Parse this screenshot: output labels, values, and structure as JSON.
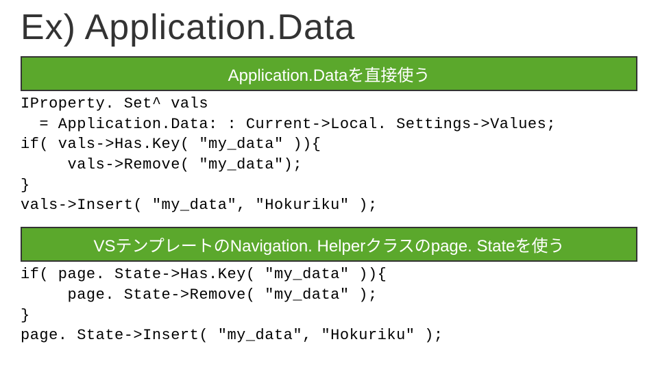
{
  "title": "Ex) Application.Data",
  "banner1": "Application.Dataを直接使う",
  "code1": "IProperty. Set^ vals\n  = Application.Data: : Current->Local. Settings->Values;\nif( vals->Has.Key( \"my_data\" )){\n     vals->Remove( \"my_data\");\n}\nvals->Insert( \"my_data\", \"Hokuriku\" );",
  "banner2": "VSテンプレートのNavigation. Helperクラスのpage. Stateを使う",
  "code2": "if( page. State->Has.Key( \"my_data\" )){\n     page. State->Remove( \"my_data\" );\n}\npage. State->Insert( \"my_data\", \"Hokuriku\" );"
}
